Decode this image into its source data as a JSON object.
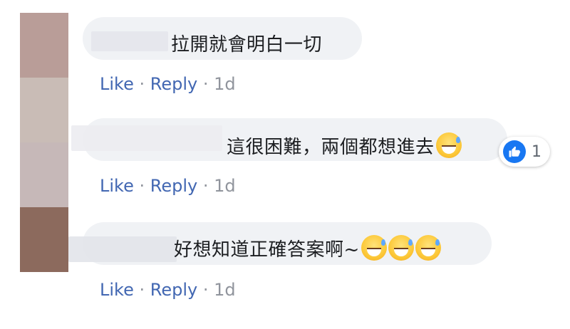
{
  "avatar_colors": [
    "#b99d98",
    "#c9bcb6",
    "#c6b8b8",
    "#8c6a5d"
  ],
  "comments": [
    {
      "text": "拉開就會明白一切",
      "emoji_count": 0,
      "like_label": "Like",
      "reply_label": "Reply",
      "separator": "·",
      "time": "1d"
    },
    {
      "text": "這很困難，兩個都想進去",
      "emoji_count": 1,
      "like_label": "Like",
      "reply_label": "Reply",
      "separator": "·",
      "time": "1d",
      "reaction": {
        "icon": "thumbs-up-icon",
        "count": "1",
        "color": "#1877f2"
      }
    },
    {
      "text": "好想知道正確答案啊~",
      "emoji_count": 3,
      "like_label": "Like",
      "reply_label": "Reply",
      "separator": "·",
      "time": "1d"
    }
  ],
  "colors": {
    "bubble": "#f0f2f5",
    "link": "#4267b2",
    "muted": "#90949c",
    "text": "#1c1e21"
  }
}
